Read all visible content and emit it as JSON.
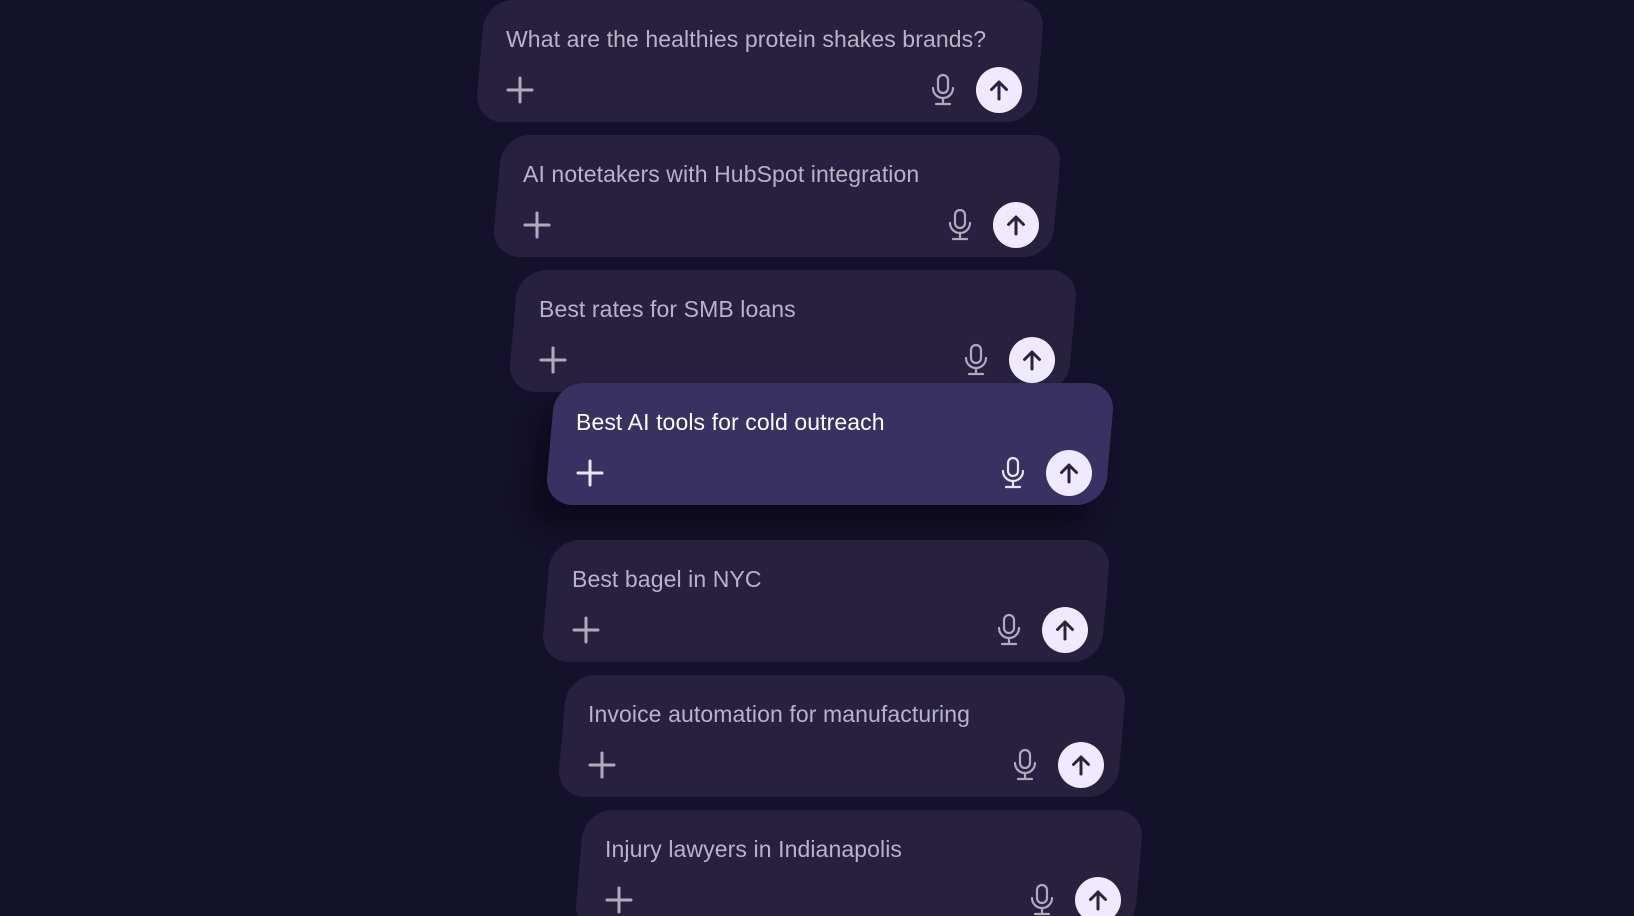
{
  "colors": {
    "background": "#14112a",
    "card": "#27213f",
    "card_active": "#3a3163",
    "send_button": "#efeaff",
    "icon_dim": "#b0aabd",
    "icon_active": "#e9e5f5"
  },
  "prompts": [
    {
      "text": "What are the healthies protein shakes brands?",
      "active": false
    },
    {
      "text": "AI notetakers with HubSpot integration",
      "active": false
    },
    {
      "text": "Best rates for SMB loans",
      "active": false
    },
    {
      "text": "Best AI tools for cold outreach",
      "active": true
    },
    {
      "text": "Best bagel in NYC",
      "active": false
    },
    {
      "text": "Invoice automation for manufacturing",
      "active": false
    },
    {
      "text": "Injury lawyers in Indianapolis",
      "active": false
    }
  ],
  "icons": {
    "add": "plus-icon",
    "voice": "microphone-icon",
    "submit": "arrow-up-icon"
  }
}
